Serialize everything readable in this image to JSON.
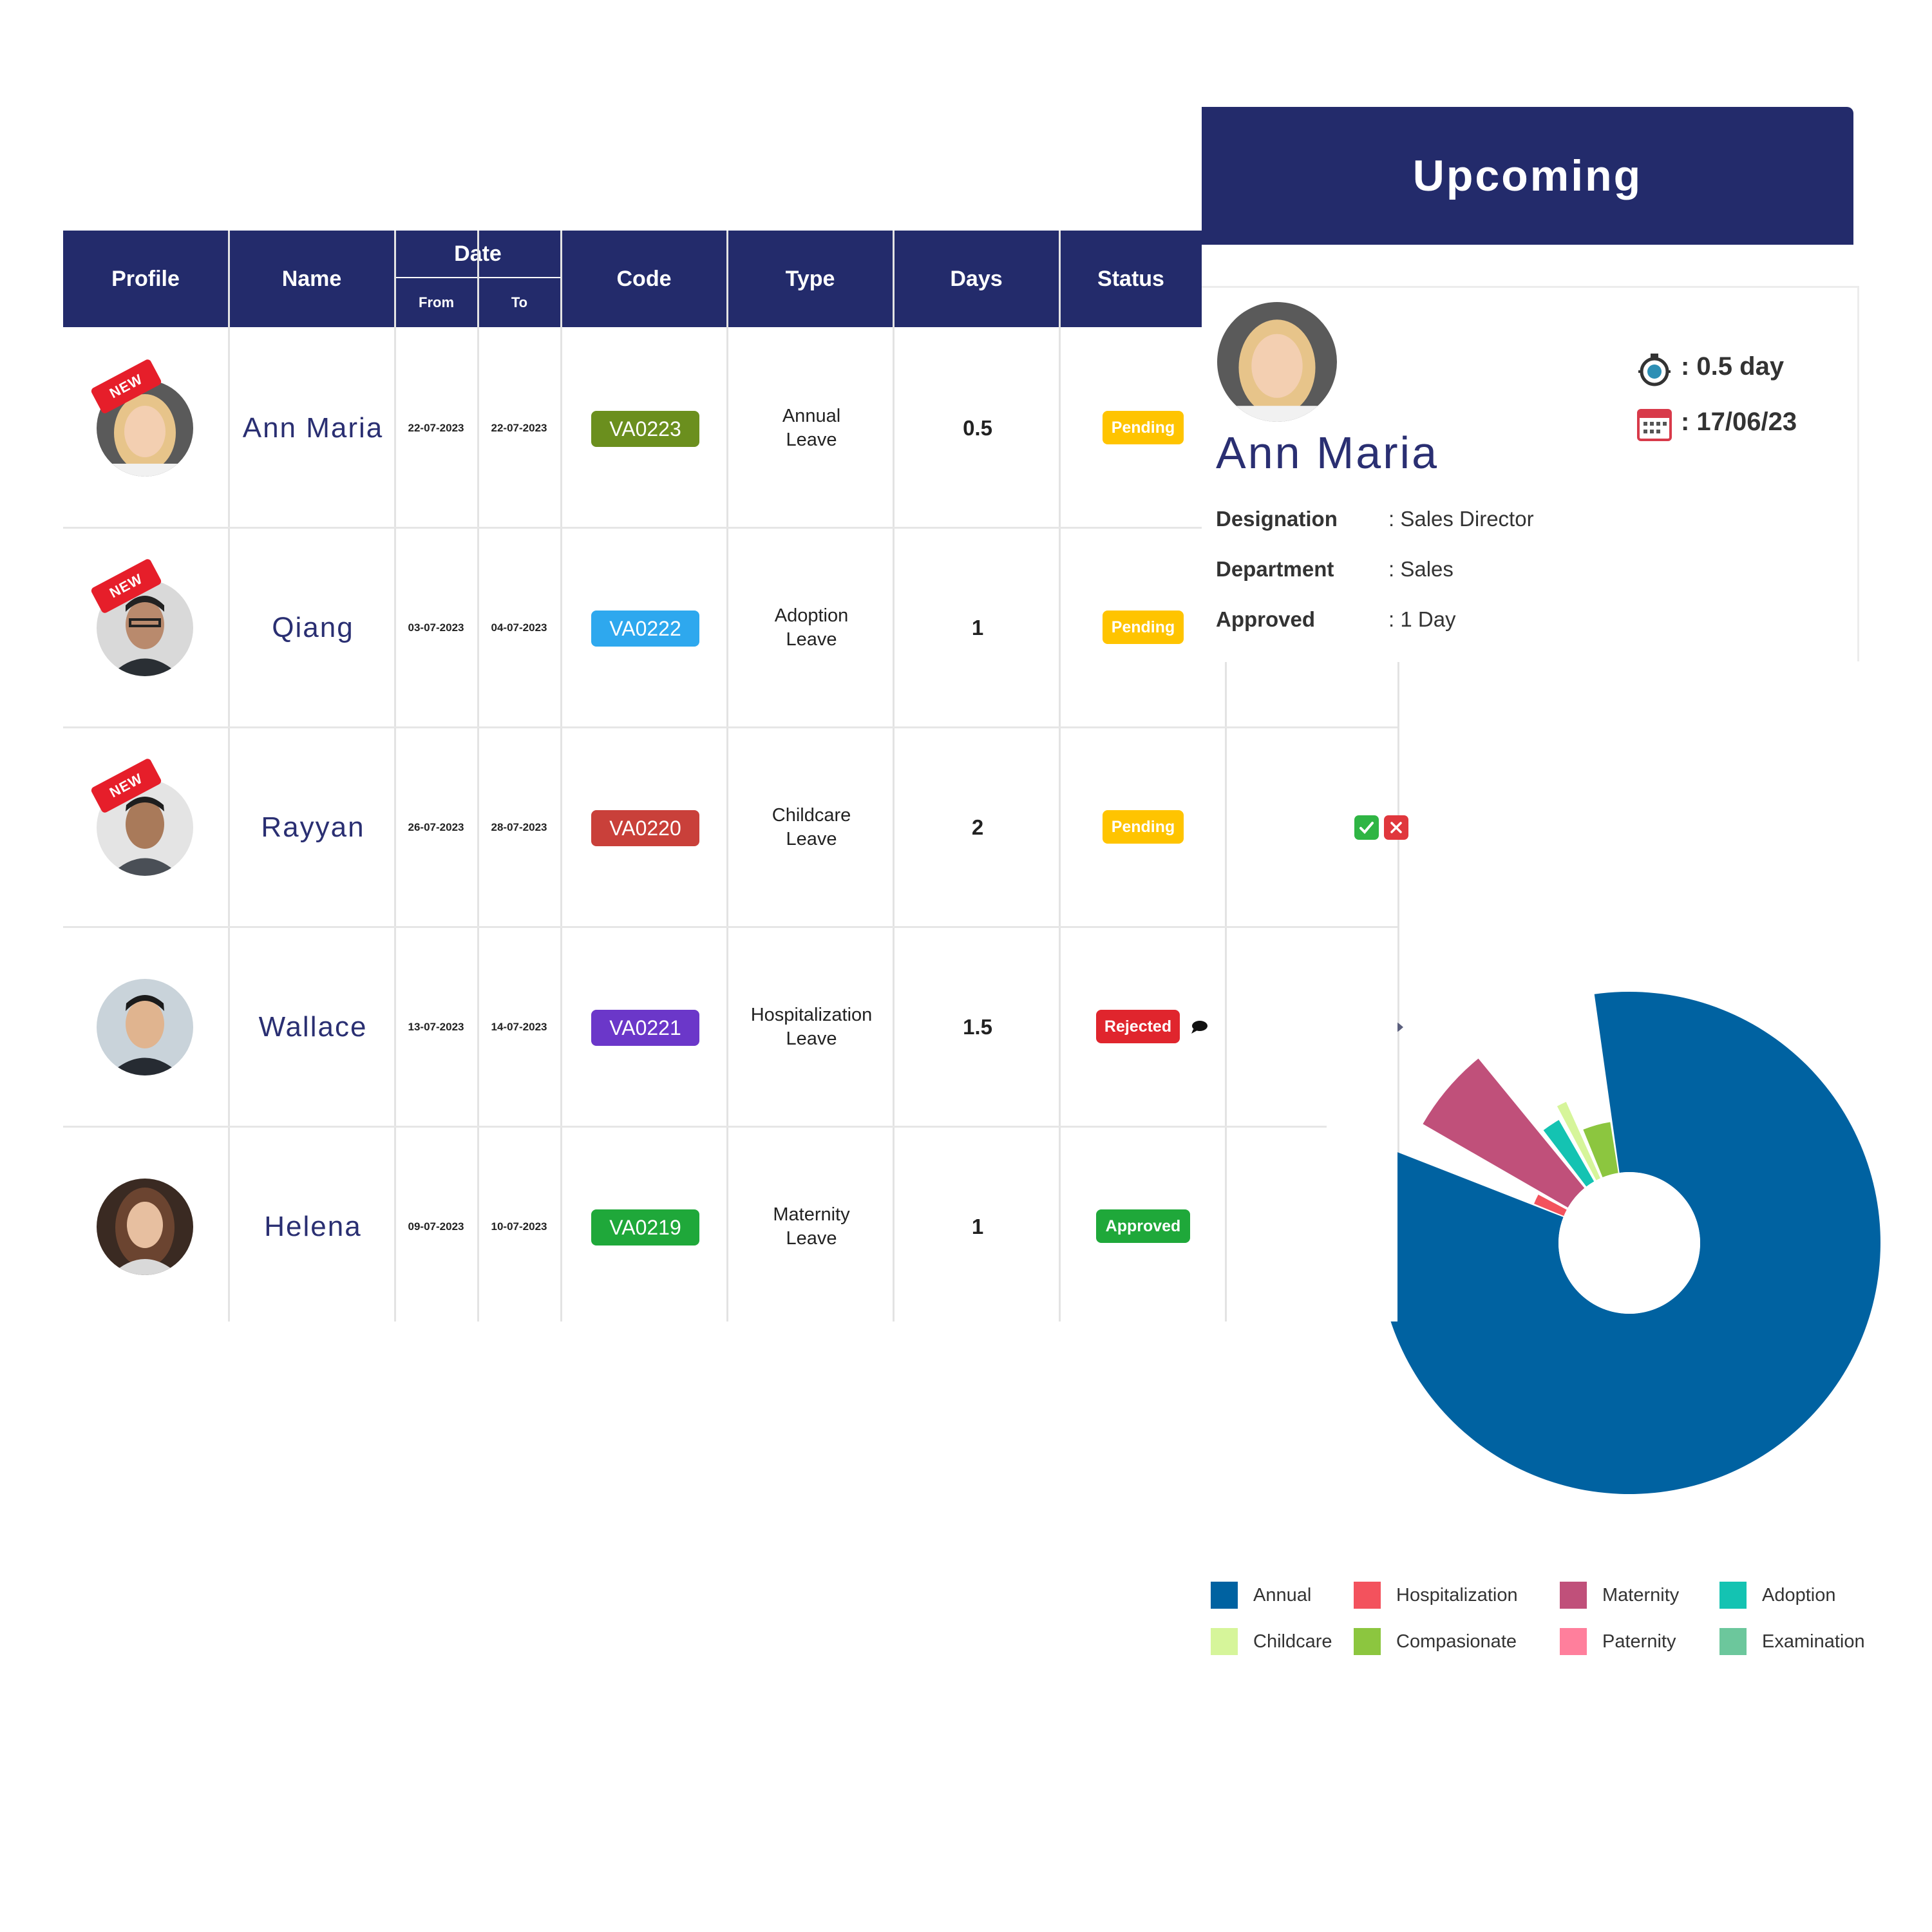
{
  "table": {
    "headers": {
      "profile": "Profile",
      "name": "Name",
      "date": "Date",
      "from": "From",
      "to": "To",
      "code": "Code",
      "type": "Type",
      "days": "Days",
      "status": "Status"
    },
    "new_badge": "NEW",
    "rows": [
      {
        "name": "Ann Maria",
        "from": "22-07-2023",
        "to": "22-07-2023",
        "code": "VA0223",
        "code_color": "#6b8f1e",
        "type_line1": "Annual",
        "type_line2": "Leave",
        "days": "0.5",
        "status": "Pending",
        "status_color": "#ffc400"
      },
      {
        "name": "Qiang",
        "from": "03-07-2023",
        "to": "04-07-2023",
        "code": "VA0222",
        "code_color": "#2ea8ee",
        "type_line1": "Adoption",
        "type_line2": "Leave",
        "days": "1",
        "status": "Pending",
        "status_color": "#ffc400"
      },
      {
        "name": "Rayyan",
        "from": "26-07-2023",
        "to": "28-07-2023",
        "code": "VA0220",
        "code_color": "#c9403a",
        "type_line1": "Childcare",
        "type_line2": "Leave",
        "days": "2",
        "status": "Pending",
        "status_color": "#ffc400"
      },
      {
        "name": "Wallace",
        "from": "13-07-2023",
        "to": "14-07-2023",
        "code": "VA0221",
        "code_color": "#6b37c9",
        "type_line1": "Hospitalization",
        "type_line2": "Leave",
        "days": "1.5",
        "status": "Rejected",
        "status_color": "#e0252d"
      },
      {
        "name": "Helena",
        "from": "09-07-2023",
        "to": "10-07-2023",
        "code": "VA0219",
        "code_color": "#1fa83a",
        "type_line1": "Maternity",
        "type_line2": "Leave",
        "days": "1",
        "status": "Approved",
        "status_color": "#1fa83a"
      }
    ]
  },
  "upcoming": {
    "title": "Upcoming",
    "name": "Ann Maria",
    "duration": ": 0.5 day",
    "date": ": 17/06/23",
    "designation_label": "Designation",
    "designation_value": ": Sales Director",
    "department_label": "Department",
    "department_value": ": Sales",
    "approved_label": "Approved",
    "approved_value": ": 1 Day"
  },
  "chart_data": {
    "type": "pie",
    "variant": "donut",
    "legend": [
      "Annual",
      "Hospitalization",
      "Maternity",
      "Adoption",
      "Childcare",
      "Compasionate",
      "Paternity",
      "Examination"
    ],
    "colors": [
      "#0062a1",
      "#f3525d",
      "#c0507a",
      "#14c3b2",
      "#d6f59a",
      "#8cc63f",
      "#ff7f9c",
      "#6cc79c"
    ],
    "values": [
      79,
      2,
      6,
      2.5,
      1.5,
      4,
      0,
      0
    ]
  }
}
